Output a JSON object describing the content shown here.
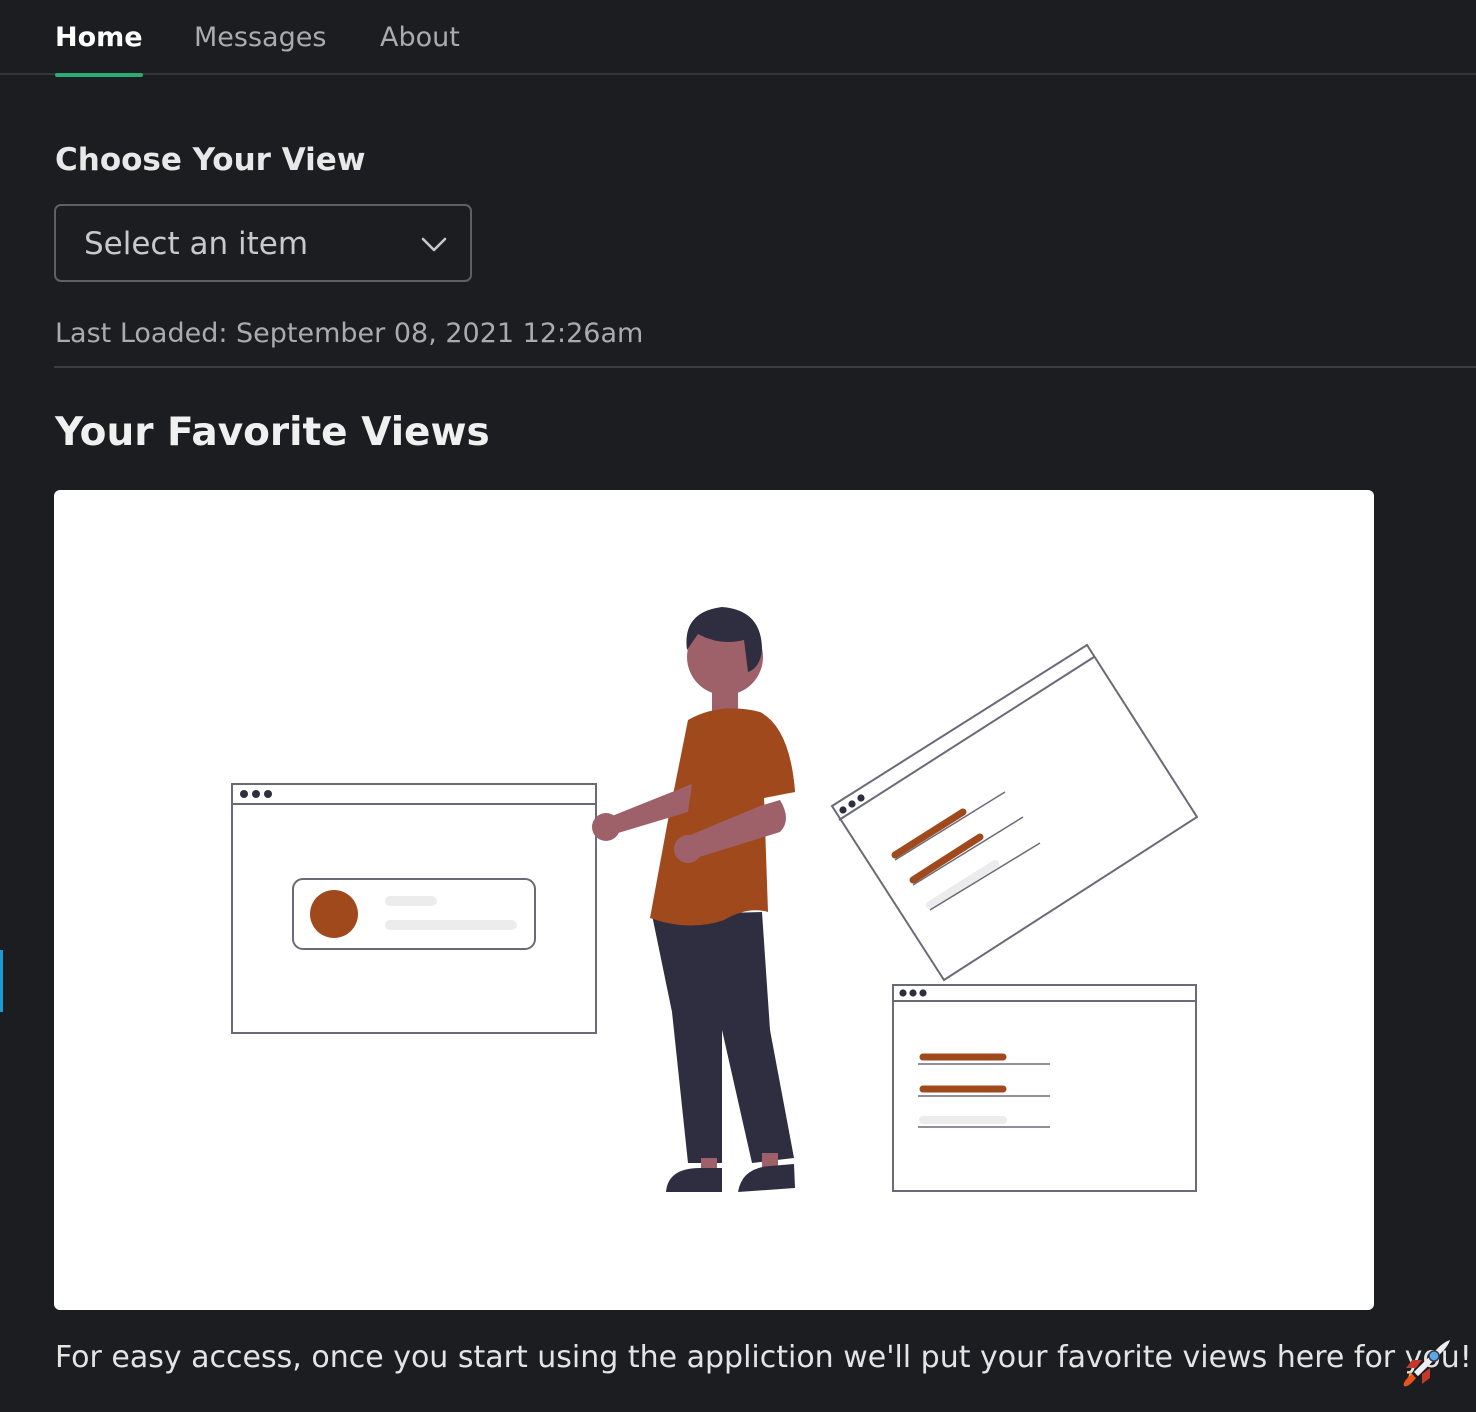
{
  "tabs": [
    {
      "label": "Home",
      "active": true
    },
    {
      "label": "Messages",
      "active": false
    },
    {
      "label": "About",
      "active": false
    }
  ],
  "main": {
    "choose_title": "Choose Your View",
    "select": {
      "placeholder": "Select an item",
      "icon": "chevron-down-icon"
    },
    "last_loaded": "Last Loaded: September 08, 2021 12:26am",
    "favorites_title": "Your Favorite Views",
    "empty_message": "For easy access, once you start using the appliction we'll put your favorite views here for you!",
    "empty_emoji_icon": "rocket-icon"
  },
  "colors": {
    "background": "#1b1d21",
    "accent": "#2bac76",
    "illustration_accent": "#a0491c",
    "illustration_dark": "#2f2e41",
    "skin": "#9e616a"
  }
}
